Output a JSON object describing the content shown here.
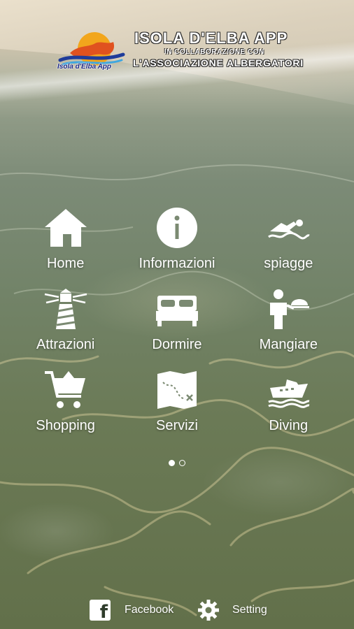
{
  "header": {
    "logo_caption": "Isola d'Elba App",
    "title_line1": "ISOLA D'ELBA APP",
    "title_line2": "IN COLLABORAZIONE CON",
    "title_line3": "L'ASSOCIAZIONE ALBERGATORI"
  },
  "menu": {
    "items": [
      {
        "label": "Home",
        "icon": "home-icon"
      },
      {
        "label": "Informazioni",
        "icon": "info-icon"
      },
      {
        "label": "spiagge",
        "icon": "swimmer-icon"
      },
      {
        "label": "Attrazioni",
        "icon": "lighthouse-icon"
      },
      {
        "label": "Dormire",
        "icon": "bed-icon"
      },
      {
        "label": "Mangiare",
        "icon": "waiter-icon"
      },
      {
        "label": "Shopping",
        "icon": "cart-icon"
      },
      {
        "label": "Servizi",
        "icon": "map-icon"
      },
      {
        "label": "Diving",
        "icon": "boat-icon"
      }
    ]
  },
  "pager": {
    "pages": 2,
    "current": 1
  },
  "footer": {
    "facebook_label": "Facebook",
    "facebook_icon": "facebook-icon",
    "setting_label": "Setting",
    "setting_icon": "gear-icon"
  },
  "colors": {
    "icon": "#ffffff",
    "text": "#ffffff"
  }
}
